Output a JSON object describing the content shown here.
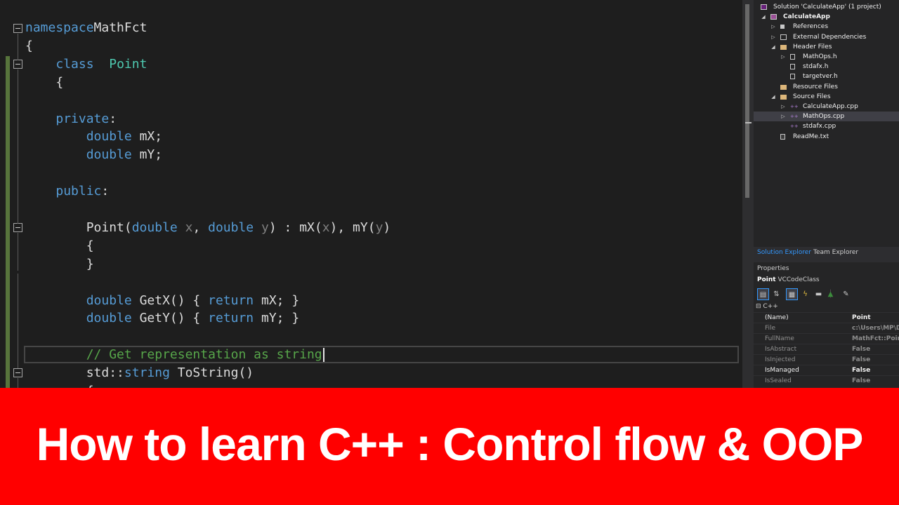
{
  "editor": {
    "lines": [
      [
        [
          "kw",
          "namespace"
        ],
        [
          "",
          "Math"
        ],
        [
          "",
          "Fct"
        ]
      ],
      [
        [
          "",
          "{"
        ]
      ],
      [
        [
          "",
          "    "
        ],
        [
          "kw",
          "class"
        ],
        [
          "",
          "  "
        ],
        [
          "ty",
          "Point"
        ]
      ],
      [
        [
          "",
          "    {"
        ]
      ],
      [
        [
          "",
          ""
        ]
      ],
      [
        [
          "",
          "    "
        ],
        [
          "kw",
          "private"
        ],
        [
          "",
          ":"
        ]
      ],
      [
        [
          "",
          "        "
        ],
        [
          "kw",
          "double"
        ],
        [
          "",
          " mX;"
        ]
      ],
      [
        [
          "",
          "        "
        ],
        [
          "kw",
          "double"
        ],
        [
          "",
          " mY;"
        ]
      ],
      [
        [
          "",
          ""
        ]
      ],
      [
        [
          "",
          "    "
        ],
        [
          "kw",
          "public"
        ],
        [
          "",
          ":"
        ]
      ],
      [
        [
          "",
          ""
        ]
      ],
      [
        [
          "",
          "        Point("
        ],
        [
          "kw",
          "double"
        ],
        [
          "pm",
          " x"
        ],
        [
          "",
          ", "
        ],
        [
          "kw",
          "double"
        ],
        [
          "pm",
          " y"
        ],
        [
          "",
          ") : mX("
        ],
        [
          "pm",
          "x"
        ],
        [
          "",
          "), mY("
        ],
        [
          "pm",
          "y"
        ],
        [
          "",
          ")"
        ]
      ],
      [
        [
          "",
          "        {"
        ]
      ],
      [
        [
          "",
          "        }"
        ]
      ],
      [
        [
          "",
          ""
        ]
      ],
      [
        [
          "",
          "        "
        ],
        [
          "kw",
          "double"
        ],
        [
          "",
          " GetX() { "
        ],
        [
          "kw",
          "return"
        ],
        [
          "",
          " mX; }"
        ]
      ],
      [
        [
          "",
          "        "
        ],
        [
          "kw",
          "double"
        ],
        [
          "",
          " GetY() { "
        ],
        [
          "kw",
          "return"
        ],
        [
          "",
          " mY; }"
        ]
      ],
      [
        [
          "",
          ""
        ]
      ],
      [
        [
          "",
          "        "
        ],
        [
          "cm",
          "// Get representation as string"
        ]
      ],
      [
        [
          "",
          "        std::"
        ],
        [
          "kw",
          "string"
        ],
        [
          "",
          " ToString()"
        ]
      ],
      [
        [
          "",
          "        {"
        ]
      ]
    ]
  },
  "solution_explorer": {
    "rows": [
      {
        "label": "Solution 'CalculateApp' (1 project)",
        "icon": "solution-icon",
        "bold": false,
        "indent": 0,
        "arrow": ""
      },
      {
        "label": "CalculateApp",
        "icon": "project-icon",
        "bold": true,
        "indent": 1,
        "arrow": "◢"
      },
      {
        "label": "References",
        "icon": "references-icon",
        "bold": false,
        "indent": 2,
        "arrow": "▷"
      },
      {
        "label": "External Dependencies",
        "icon": "dependencies-icon",
        "bold": false,
        "indent": 2,
        "arrow": "▷"
      },
      {
        "label": "Header Files",
        "icon": "folder-icon",
        "bold": false,
        "indent": 2,
        "arrow": "◢"
      },
      {
        "label": "MathOps.h",
        "icon": "header-file-icon",
        "bold": false,
        "indent": 3,
        "arrow": "▷"
      },
      {
        "label": "stdafx.h",
        "icon": "header-file-icon",
        "bold": false,
        "indent": 3,
        "arrow": ""
      },
      {
        "label": "targetver.h",
        "icon": "header-file-icon",
        "bold": false,
        "indent": 3,
        "arrow": ""
      },
      {
        "label": "Resource Files",
        "icon": "folder-icon",
        "bold": false,
        "indent": 2,
        "arrow": ""
      },
      {
        "label": "Source Files",
        "icon": "folder-icon",
        "bold": false,
        "indent": 2,
        "arrow": "◢"
      },
      {
        "label": "CalculateApp.cpp",
        "icon": "cpp-file-icon",
        "bold": false,
        "indent": 3,
        "arrow": "▷"
      },
      {
        "label": "MathOps.cpp",
        "icon": "cpp-file-icon",
        "bold": false,
        "indent": 3,
        "arrow": "▷",
        "selected": true
      },
      {
        "label": "stdafx.cpp",
        "icon": "cpp-file-icon",
        "bold": false,
        "indent": 3,
        "arrow": ""
      },
      {
        "label": "ReadMe.txt",
        "icon": "text-file-icon",
        "bold": false,
        "indent": 2,
        "arrow": ""
      }
    ],
    "tabs": {
      "solution": "Solution Explorer",
      "team": "Team Explorer"
    }
  },
  "properties": {
    "title": "Properties",
    "object_name": "Point",
    "object_type": "VCCodeClass",
    "category": "C++",
    "rows": [
      {
        "name": "(Name)",
        "value": "Point",
        "strong": true
      },
      {
        "name": "File",
        "value": "c:\\Users\\MP\\De",
        "strong": false
      },
      {
        "name": "FullName",
        "value": "MathFct::Point",
        "strong": false
      },
      {
        "name": "IsAbstract",
        "value": "False",
        "strong": false
      },
      {
        "name": "IsInjected",
        "value": "False",
        "strong": false
      },
      {
        "name": "IsManaged",
        "value": "False",
        "strong": true
      },
      {
        "name": "IsSealed",
        "value": "False",
        "strong": false
      }
    ]
  },
  "banner": {
    "title": "How to learn C++ : Control flow & OOP",
    "background": "#ff0000"
  }
}
